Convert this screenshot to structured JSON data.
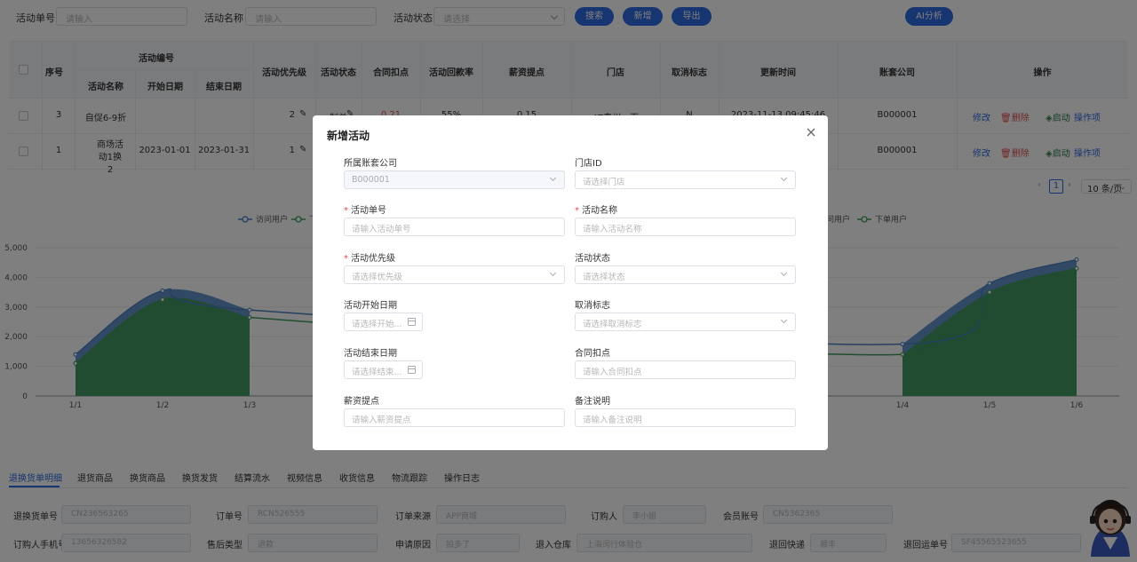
{
  "filters": {
    "order_label": "活动单号",
    "order_placeholder": "请输入",
    "name_label": "活动名称",
    "name_placeholder": "请输入",
    "status_label": "活动状态",
    "status_placeholder": "请选择",
    "search": "搜索",
    "add": "新增",
    "export": "导出",
    "ai": "AI分析"
  },
  "table": {
    "headers": {
      "index": "序号",
      "code": "活动编号",
      "name": "活动名称",
      "start": "开始日期",
      "end": "结束日期",
      "priority": "活动优先级",
      "status": "活动状态",
      "discount": "合同扣点",
      "recovery": "活动回款率",
      "salary": "薪资提点",
      "store": "门店",
      "cancel": "取消标志",
      "updated": "更新时间",
      "company": "账套公司",
      "ops": "操作"
    },
    "rows": [
      {
        "index": "3",
        "name": "自促6-9折",
        "start": "",
        "end": "",
        "priority": "2",
        "status": "制单",
        "discount": "0.21",
        "recovery": "55%",
        "salary": "0.15",
        "store": "AT泰州一百",
        "cancel": "N",
        "updated": "2023-11-13 09:45:46",
        "company": "B000001"
      },
      {
        "index": "1",
        "name": "商场活动1换2",
        "start": "2023-01-01",
        "end": "2023-01-31",
        "priority": "1",
        "status": "",
        "discount": "",
        "recovery": "",
        "salary": "",
        "store": "",
        "cancel": "",
        "updated": "",
        "company": "B000001"
      }
    ],
    "ops": {
      "edit": "修改",
      "delete": "删除",
      "start": "启动",
      "items": "操作项"
    }
  },
  "pager": {
    "page": "1",
    "size": "10 条/页"
  },
  "chart_data": {
    "type": "area",
    "categories": [
      "1/1",
      "1/2",
      "1/3",
      "1/4",
      "1/5",
      "1/6"
    ],
    "series": [
      {
        "name": "访问用户",
        "color": "#4a7fc1",
        "values": [
          1400,
          3550,
          2900,
          1750,
          3800,
          4600
        ]
      },
      {
        "name": "下单用户",
        "color": "#3f9a5a",
        "values": [
          1100,
          3250,
          2650,
          1400,
          3500,
          4300
        ]
      }
    ],
    "ylim": [
      0,
      5000
    ],
    "yticks": [
      "0",
      "1,000",
      "2,000",
      "3,000",
      "4,000",
      "5,000"
    ],
    "legend_fragment_left": "下",
    "legend_fragment_right": "问用户"
  },
  "tabs": [
    "退换货单明细",
    "退货商品",
    "换货商品",
    "换货发货",
    "结算流水",
    "视频信息",
    "收货信息",
    "物流跟踪",
    "操作日志"
  ],
  "bottom_form": {
    "row1": [
      {
        "label": "退换货单号",
        "value": "CN236563265"
      },
      {
        "label": "订单号",
        "value": "RCN526555"
      },
      {
        "label": "订单来源",
        "value": "APP商城"
      },
      {
        "label": "订购人",
        "value": "李小姐"
      },
      {
        "label": "会员账号",
        "value": "CN5362365"
      }
    ],
    "row2": [
      {
        "label": "订购人手机号",
        "value": "13656326582"
      },
      {
        "label": "售后类型",
        "value": "退款"
      },
      {
        "label": "申请原因",
        "value": "拍多了"
      },
      {
        "label": "退入仓库",
        "value": "上海闵行体验仓"
      },
      {
        "label": "退回快递",
        "value": "顺丰"
      },
      {
        "label": "退回运单号",
        "value": "SF45565523655"
      }
    ]
  },
  "modal": {
    "title": "新增活动",
    "fields": {
      "company_label": "所属账套公司",
      "company_value": "B000001",
      "store_label": "门店ID",
      "store_placeholder": "请选择门店",
      "order_label": "活动单号",
      "order_placeholder": "请输入活动单号",
      "name_label": "活动名称",
      "name_placeholder": "请输入活动名称",
      "priority_label": "活动优先级",
      "priority_placeholder": "请选择优先级",
      "status_label": "活动状态",
      "status_placeholder": "请选择状态",
      "start_label": "活动开始日期",
      "start_placeholder": "请选择开始...",
      "cancel_label": "取消标志",
      "cancel_placeholder": "请选择取消标志",
      "end_label": "活动结束日期",
      "end_placeholder": "请选择结束...",
      "discount_label": "合同扣点",
      "discount_placeholder": "请输入合同扣点",
      "salary_label": "薪资提点",
      "salary_placeholder": "请输入薪资提点",
      "remark_label": "备注说明",
      "remark_placeholder": "请输入备注说明"
    }
  }
}
